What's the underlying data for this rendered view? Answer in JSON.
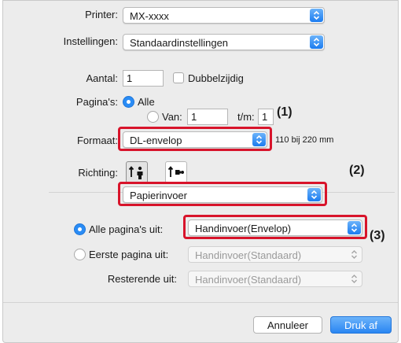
{
  "printer": {
    "label": "Printer:",
    "value": "MX-xxxx"
  },
  "presets": {
    "label": "Instellingen:",
    "value": "Standaardinstellingen"
  },
  "copies": {
    "label": "Aantal:",
    "value": "1",
    "duplex_label": "Dubbelzijdig"
  },
  "pages": {
    "label": "Pagina's:",
    "all_label": "Alle",
    "from_label": "Van:",
    "from_value": "1",
    "to_label": "t/m:",
    "to_value": "1"
  },
  "format": {
    "label": "Formaat:",
    "value": "DL-envelop",
    "size_text": "110 bij 220 mm"
  },
  "orientation": {
    "label": "Richting:",
    "options": [
      "portrait-icon",
      "landscape-icon"
    ],
    "selected": "portrait-icon"
  },
  "section": {
    "value": "Papierinvoer"
  },
  "feed": {
    "all_pages_label": "Alle pagina's uit:",
    "all_pages_value": "Handinvoer(Envelop)",
    "first_page_label": "Eerste pagina uit:",
    "first_page_value": "Handinvoer(Standaard)",
    "remaining_label": "Resterende uit:",
    "remaining_value": "Handinvoer(Standaard)"
  },
  "callouts": {
    "c1": "(1)",
    "c2": "(2)",
    "c3": "(3)"
  },
  "buttons": {
    "cancel": "Annuleer",
    "print": "Druk af"
  },
  "colors": {
    "accent": "#2a8cf5",
    "highlight": "#d8142b",
    "background": "#ececec"
  }
}
